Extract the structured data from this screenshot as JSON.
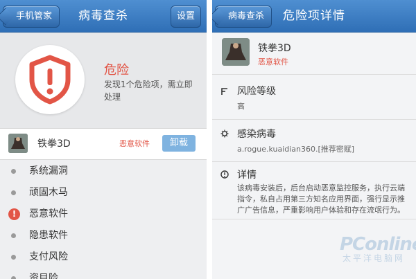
{
  "left": {
    "header": {
      "back_label": "手机管家",
      "title": "病毒查杀",
      "settings_label": "设置"
    },
    "status": {
      "title": "危险",
      "description": "发现1个危险项，需立即处理"
    },
    "threat": {
      "name": "铁拳3D",
      "tag": "恶意软件",
      "uninstall_label": "卸载"
    },
    "categories": [
      {
        "label": "系统漏洞",
        "state": "ok"
      },
      {
        "label": "顽固木马",
        "state": "ok"
      },
      {
        "label": "恶意软件",
        "state": "alert"
      },
      {
        "label": "隐患软件",
        "state": "ok"
      },
      {
        "label": "支付风险",
        "state": "ok"
      },
      {
        "label": "资目险",
        "state": "ok"
      }
    ]
  },
  "right": {
    "header": {
      "back_label": "病毒查杀",
      "title": "危险项详情"
    },
    "app": {
      "name": "铁拳3D",
      "tag": "恶意软件"
    },
    "risk_level": {
      "title": "风险等级",
      "value": "高"
    },
    "virus": {
      "title": "感染病毒",
      "value": "a.rogue.kuaidian360.[推荐密赋]"
    },
    "details": {
      "title": "详情",
      "text": "该病毒安装后，后台启动恶意监控服务，执行云端指令，私自占用第三方知名应用界面，强行显示推广广告信息，严重影响用户体验和存在流氓行为。"
    }
  },
  "watermark": {
    "logo": "PConline",
    "sub": "太平洋电脑网"
  },
  "colors": {
    "header_blue": "#2f6fb6",
    "danger_red": "#e25546",
    "button_blue": "#7fb3e0"
  },
  "icons": [
    "shield-alert-icon",
    "flag-icon",
    "bug-icon",
    "info-icon",
    "alert-icon"
  ]
}
